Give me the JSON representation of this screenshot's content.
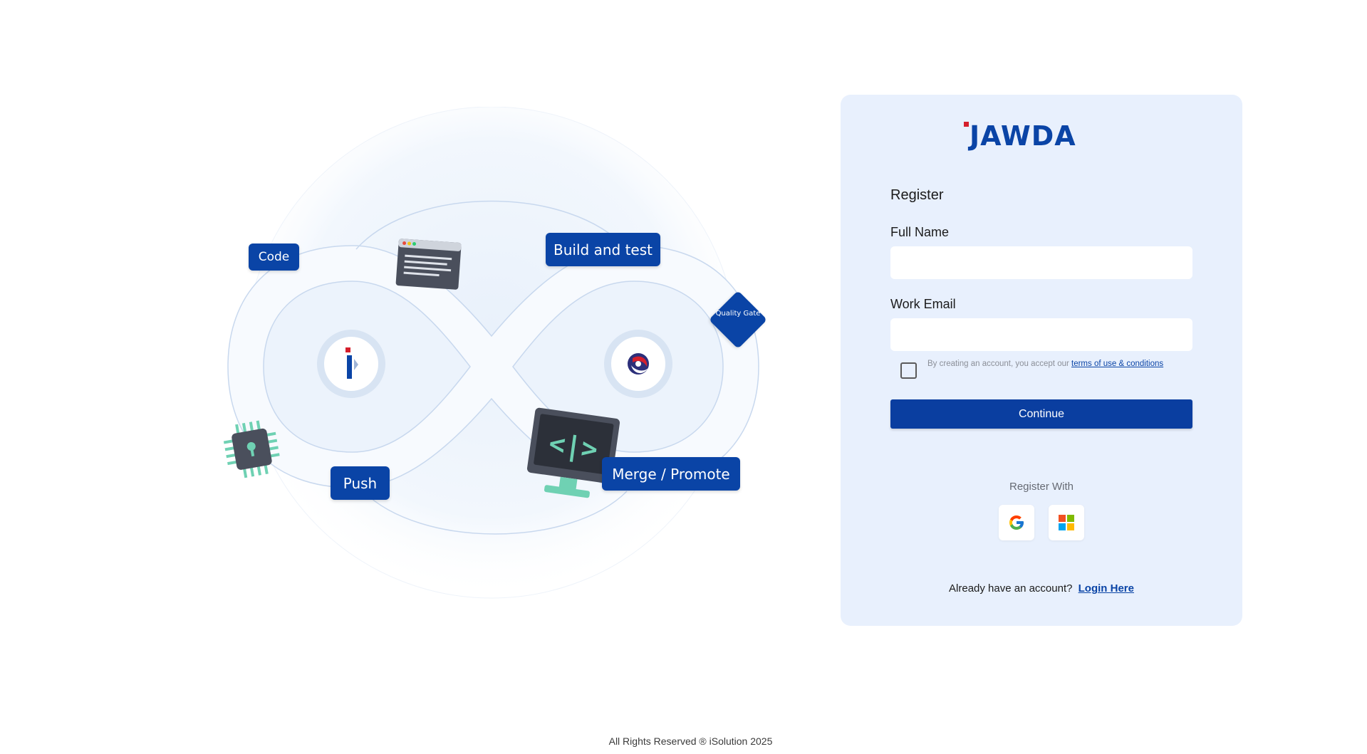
{
  "illustration": {
    "labels": {
      "code": "Code",
      "build": "Build and test",
      "quality_gate": "Quality Gate",
      "push": "Push",
      "merge": "Merge / Promote"
    },
    "accent_color": "#0a44a6"
  },
  "brand": {
    "name": "JAWDA",
    "color": "#0a44a6",
    "accent": "#d51f2c"
  },
  "form": {
    "title": "Register",
    "full_name_label": "Full Name",
    "full_name_value": "",
    "work_email_label": "Work Email",
    "work_email_value": "",
    "terms_prefix": "By creating an account, you accept our ",
    "terms_link": " terms of use & conditions",
    "terms_checked": false,
    "continue_label": "Continue",
    "register_with": "Register With",
    "social": [
      {
        "provider": "Google",
        "icon": "google-icon"
      },
      {
        "provider": "Microsoft",
        "icon": "microsoft-icon"
      }
    ],
    "login_prompt": "Already have an account?",
    "login_link": "Login Here"
  },
  "footer": {
    "text": "All Rights Reserved ® iSolution 2025"
  }
}
